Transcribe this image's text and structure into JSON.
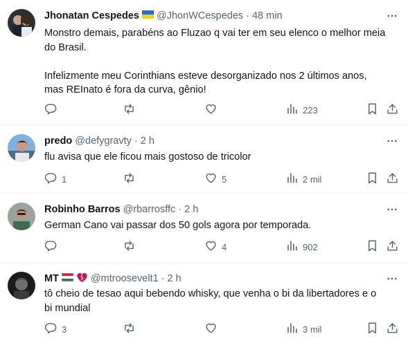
{
  "tweets": [
    {
      "name": "Jhonatan Cespedes",
      "flag": "ukraine-flag",
      "handle": "@JhonWCespedes",
      "sep": "·",
      "time": "48 min",
      "text": "Monstro demais, parabéns ao Fluzao q vai ter em seu elenco o melhor meia\ndo Brasil.\n\nInfelizmente meu Corinthians esteve desorganizado nos 2 últimos anos,\nmas REInato é fora da curva, gênio!",
      "reply": "",
      "retweet": "",
      "like": "",
      "views": "223"
    },
    {
      "name": "predo",
      "handle": "@defygravty",
      "sep": "·",
      "time": "2 h",
      "text": "flu avisa que ele ficou mais gostoso de tricolor",
      "reply": "1",
      "retweet": "",
      "like": "5",
      "views": "2 mil"
    },
    {
      "name": "Robinho Barros",
      "handle": "@rbarrosffc",
      "sep": "·",
      "time": "2 h",
      "text": "German Cano vai passar dos 50 gols agora por temporada.",
      "reply": "",
      "retweet": "",
      "like": "4",
      "views": "902"
    },
    {
      "name": "MT",
      "flag": "hungary-flag",
      "emoji": "broken-heart-icon",
      "handle": "@mtroosevelt1",
      "sep": "·",
      "time": "2 h",
      "text": "tô cheio de tesao aqui bebendo whisky, que venha o bi da libertadores e o\nbi mundial",
      "reply": "3",
      "retweet": "",
      "like": "",
      "views": "3 mil"
    }
  ],
  "colors": {
    "text": "#0f1419",
    "muted": "#536471",
    "border": "#eff3f4"
  }
}
